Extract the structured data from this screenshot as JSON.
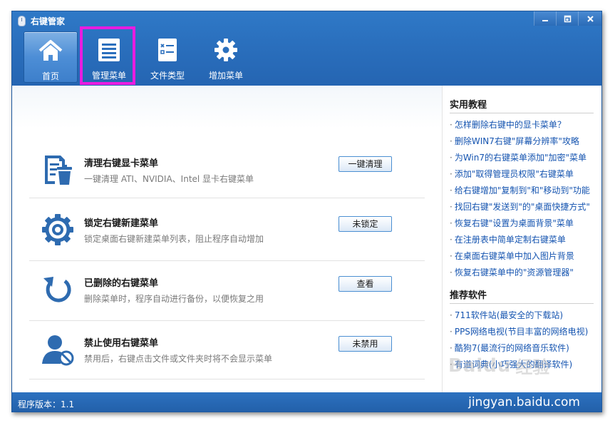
{
  "window": {
    "title": "右键管家",
    "controls": {
      "minimize": "minimize-icon",
      "restore": "restore-icon",
      "close": "close-icon"
    }
  },
  "nav": [
    {
      "label": "首页",
      "icon": "home-icon",
      "active": true
    },
    {
      "label": "管理菜单",
      "icon": "list-menu-icon",
      "active": false,
      "highlighted": true
    },
    {
      "label": "文件类型",
      "icon": "file-type-icon",
      "active": false
    },
    {
      "label": "增加菜单",
      "icon": "gear-icon",
      "active": false
    }
  ],
  "features": [
    {
      "title": "清理右键显卡菜单",
      "desc": "一键清理 ATI、NVIDIA、Intel 显卡右键菜单",
      "button": "一键清理",
      "icon": "clean-doc-trash-icon"
    },
    {
      "title": "锁定右键新建菜单",
      "desc": "锁定桌面右键新建菜单列表，阻止程序自动增加",
      "button": "未锁定",
      "icon": "gear-lock-icon"
    },
    {
      "title": "已删除的右键菜单",
      "desc": "删除菜单时，程序自动进行备份，以便恢复之用",
      "button": "查看",
      "icon": "restore-arrow-icon"
    },
    {
      "title": "禁止使用右键菜单",
      "desc": "禁用后，右键点击文件或文件夹时将不会显示菜单",
      "button": "未禁用",
      "icon": "user-forbidden-icon"
    }
  ],
  "sidebar": {
    "tutorials_heading": "实用教程",
    "tutorials": [
      "怎样删除右键中的显卡菜单？",
      "删除WIN7右键\"屏幕分辨率\"攻略",
      "为Win7的右键菜单添加\"加密\"菜单",
      "添加\"取得管理员权限\"右键菜单",
      "给右键增加\"复制到\"和\"移动到\"功能",
      "找回右键\"发送到\"的\"桌面快捷方式\"",
      "恢复右键\"设置为桌面背景\"菜单",
      "在注册表中简单定制右键菜单",
      "在桌面右键菜单中加入图片背景",
      "恢复右键菜单中的\"资源管理器\""
    ],
    "software_heading": "推荐软件",
    "software": [
      "711软件站(最安全的下载站)",
      "PPS网络电视(节目丰富的网络电视)",
      "酷狗7(最流行的网络音乐软件)",
      "有道词典(小巧强大的翻译软件)"
    ]
  },
  "status": {
    "version": "程序版本：1.1",
    "site": "jingyan.baidu.com",
    "watermark": "Baidu",
    "watermark_cn": "经验"
  },
  "colors": {
    "header_blue": "#2a6fbd",
    "link_blue": "#1554b0",
    "highlight_magenta": "#e81ce0",
    "icon_blue": "#2e6bb0"
  }
}
